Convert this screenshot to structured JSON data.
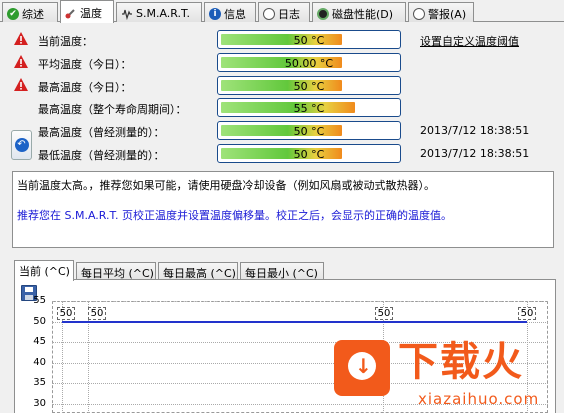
{
  "tabs": [
    {
      "label": "综述",
      "icon": "check-icon"
    },
    {
      "label": "温度",
      "icon": "thermometer-icon"
    },
    {
      "label": "S.M.A.R.T.",
      "icon": "smart-icon"
    },
    {
      "label": "信息",
      "icon": "info-icon"
    },
    {
      "label": "日志",
      "icon": "log-icon"
    },
    {
      "label": "磁盘性能(D)",
      "icon": "disk-performance-icon"
    },
    {
      "label": "警报(A)",
      "icon": "alarm-icon"
    }
  ],
  "temperature": {
    "set_threshold_link": "设置自定义温度阈值",
    "rows": [
      {
        "label": "当前温度：",
        "value": "50 °C",
        "time": "",
        "warn": true
      },
      {
        "label": "平均温度（今日）：",
        "value": "50.00 °C",
        "time": "",
        "warn": true
      },
      {
        "label": "最高温度（今日）：",
        "value": "50 °C",
        "time": "",
        "warn": true
      },
      {
        "label": "最高温度（整个寿命周期间）：",
        "value": "55 °C",
        "time": "",
        "warn": false
      },
      {
        "label": "最高温度（曾经测量的）：",
        "value": "50 °C",
        "time": "2013/7/12 18:38:51",
        "warn": false
      },
      {
        "label": "最低温度（曾经测量的）：",
        "value": "50 °C",
        "time": "2013/7/12 18:38:51",
        "warn": false
      }
    ]
  },
  "message": {
    "line1": "当前温度太高。，推荐您如果可能，请使用硬盘冷却设备（例如风扇或被动式散热器）。",
    "line2": "推荐您在 S.M.A.R.T. 页校正温度并设置温度偏移量。校正之后，会显示的正确的温度值。"
  },
  "chart_tabs": [
    "当前 (^C)",
    "每日平均 (^C)",
    "每日最高 (^C)",
    "每日最小 (^C)"
  ],
  "colors": {
    "warning": "#d42020",
    "series": "#2233cc",
    "watermark": "#f25a1b"
  },
  "chart_data": {
    "type": "line",
    "ylim": [
      30,
      55
    ],
    "yticks": [
      "55",
      "50",
      "45",
      "40",
      "35",
      "30"
    ],
    "series": [
      {
        "values": [
          50,
          50,
          50,
          50
        ]
      }
    ],
    "point_labels": [
      "50",
      "50",
      "50",
      "50"
    ]
  },
  "watermark": {
    "text": "下载火",
    "sub": "xiazaihuo.com"
  }
}
